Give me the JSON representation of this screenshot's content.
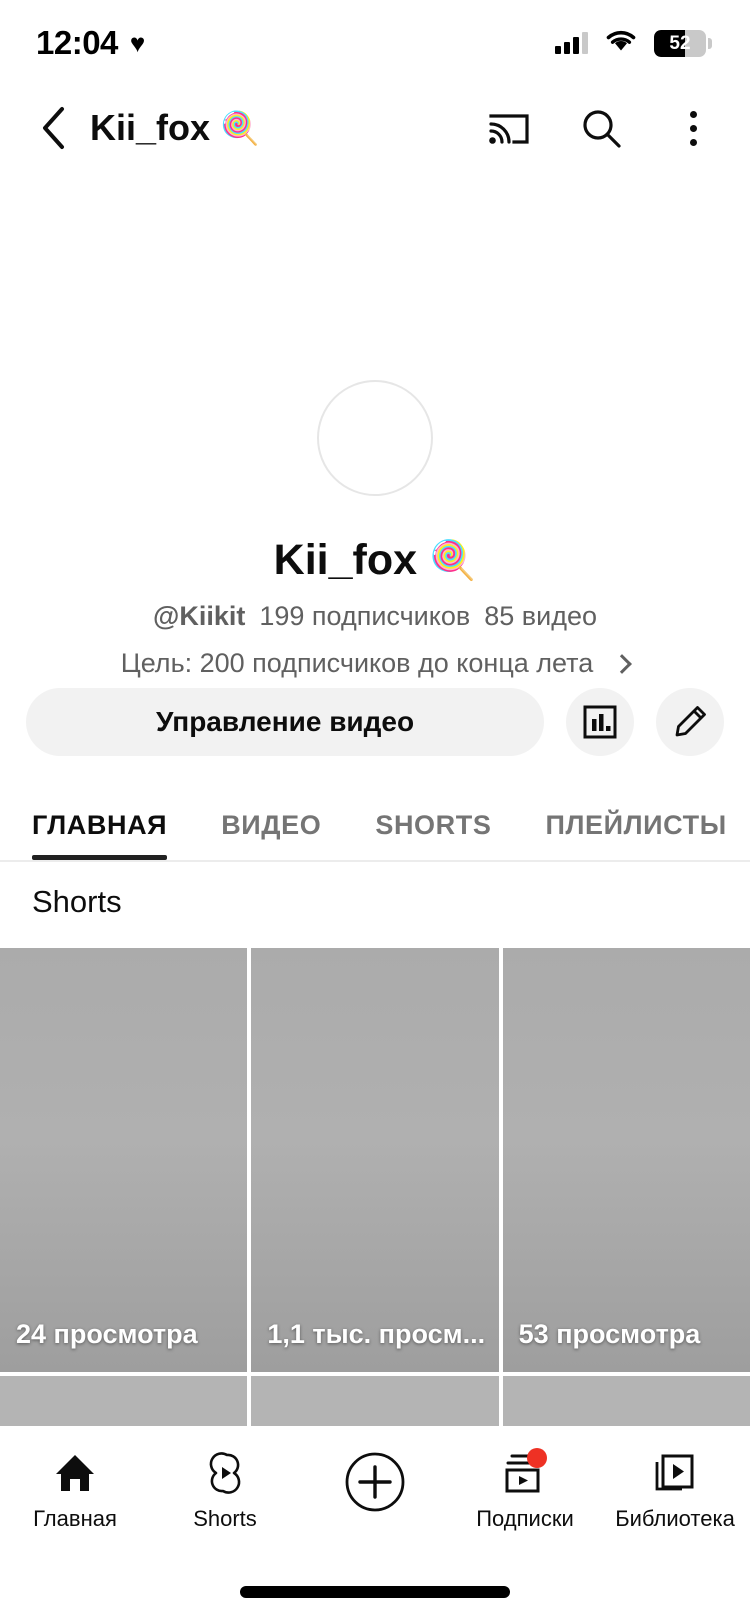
{
  "status_bar": {
    "time": "12:04",
    "heart_icon": "heart-icon",
    "signal_icon": "cellular-signal-icon",
    "wifi_icon": "wifi-icon",
    "battery_level": "52",
    "battery_icon": "battery-icon"
  },
  "header": {
    "back_icon": "back-chevron-icon",
    "title": "Kii_fox",
    "title_emoji": "🍭",
    "cast_icon": "cast-icon",
    "search_icon": "search-icon",
    "more_icon": "more-vertical-icon"
  },
  "profile": {
    "avatar_icon": "avatar-placeholder",
    "channel_name": "Kii_fox",
    "channel_emoji": "🍭",
    "handle": "@Kiikit",
    "subscribers": "199 подписчиков",
    "videos": "85 видео",
    "goal_text": "Цель: 200 подписчиков до конца лета",
    "goal_chevron_icon": "chevron-right-icon"
  },
  "actions": {
    "manage_label": "Управление видео",
    "analytics_icon": "analytics-bar-chart-icon",
    "edit_icon": "pencil-edit-icon"
  },
  "tabs": [
    {
      "label": "ГЛАВНАЯ",
      "active": true
    },
    {
      "label": "ВИДЕО",
      "active": false
    },
    {
      "label": "SHORTS",
      "active": false
    },
    {
      "label": "ПЛЕЙЛИСТЫ",
      "active": false
    }
  ],
  "shorts_section": {
    "title": "Shorts",
    "items": [
      {
        "views": "24 просмотра"
      },
      {
        "views": "1,1 тыс. просм..."
      },
      {
        "views": "53 просмотра"
      }
    ]
  },
  "bottom_nav": [
    {
      "label": "Главная",
      "icon": "home-icon",
      "badge": false
    },
    {
      "label": "Shorts",
      "icon": "shorts-icon",
      "badge": false
    },
    {
      "label": "",
      "icon": "create-plus-icon",
      "badge": false
    },
    {
      "label": "Подписки",
      "icon": "subscriptions-icon",
      "badge": true
    },
    {
      "label": "Библиотека",
      "icon": "library-icon",
      "badge": false
    }
  ],
  "colors": {
    "accent_red": "#ee3124",
    "text_primary": "#0d0d0d",
    "text_secondary": "#606060",
    "chip_bg": "#f2f2f2",
    "thumb_gray": "#ababab"
  }
}
